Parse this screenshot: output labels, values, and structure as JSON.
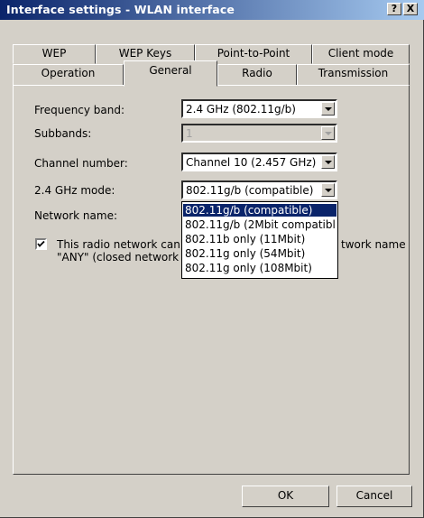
{
  "window": {
    "title": "Interface settings - WLAN interface",
    "help_label": "?",
    "close_label": "X"
  },
  "tabs": {
    "back_row": [
      "WEP",
      "WEP Keys",
      "Point-to-Point",
      "Client mode"
    ],
    "front_row": [
      "Operation",
      "General",
      "Radio",
      "Transmission"
    ],
    "active": "General"
  },
  "form": {
    "frequency_band": {
      "label": "Frequency band:",
      "value": "2.4 GHz (802.11g/b)"
    },
    "subbands": {
      "label": "Subbands:",
      "value": "1",
      "disabled": true
    },
    "channel_number": {
      "label": "Channel number:",
      "value": "Channel 10 (2.457 GHz)"
    },
    "mode": {
      "label": "2.4 GHz mode:",
      "value": "802.11g/b (compatible)",
      "options": [
        "802.11g/b (compatible)",
        "802.11g/b (2Mbit compatibl",
        "802.11b only (11Mbit)",
        "802.11g only (54Mbit)",
        "802.11g only (108Mbit)"
      ]
    },
    "network_name": {
      "label": "Network name:"
    },
    "closed_network": {
      "checked": true,
      "line1_left": "This radio network can",
      "line1_right": "twork name",
      "line2": "\"ANY\" (closed network"
    }
  },
  "buttons": {
    "ok": "OK",
    "cancel": "Cancel"
  },
  "colors": {
    "face": "#d4d0c8",
    "title_start": "#0a246a",
    "title_end": "#a6caf0",
    "selection": "#0a246a"
  }
}
